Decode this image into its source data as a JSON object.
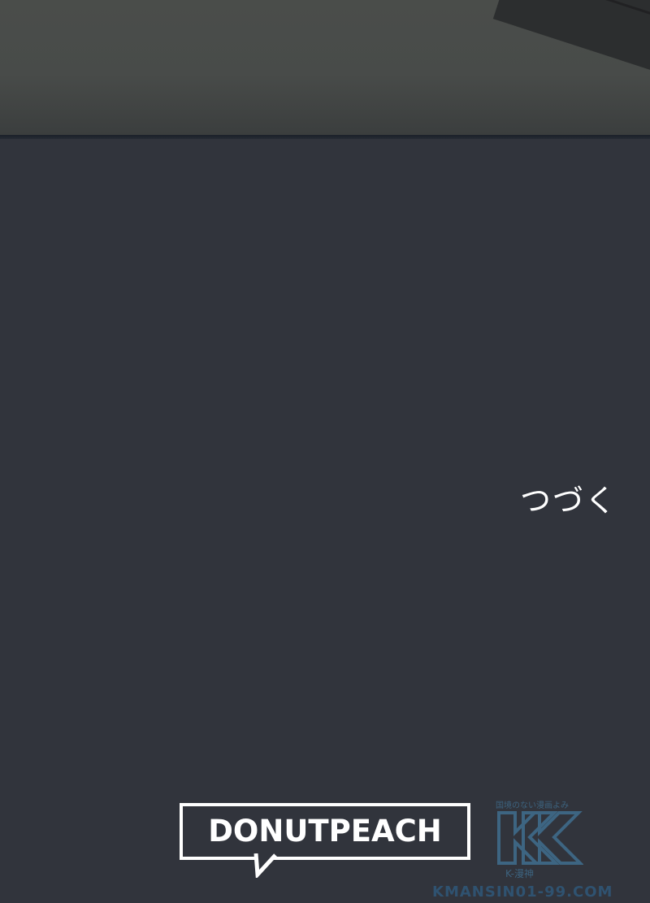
{
  "page": {
    "continued_text": "つづく"
  },
  "logos": {
    "publisher": "DONUTPEACH",
    "watermark": {
      "tagline": "国境のない漫画よみ",
      "letter": "K",
      "sub": "K-漫神",
      "site": "KMANSIN01-99.COM"
    }
  },
  "colors": {
    "background": "#31343c",
    "top_panel": "#484b49",
    "text": "#ffffff",
    "watermark": "#3f6b8a"
  }
}
